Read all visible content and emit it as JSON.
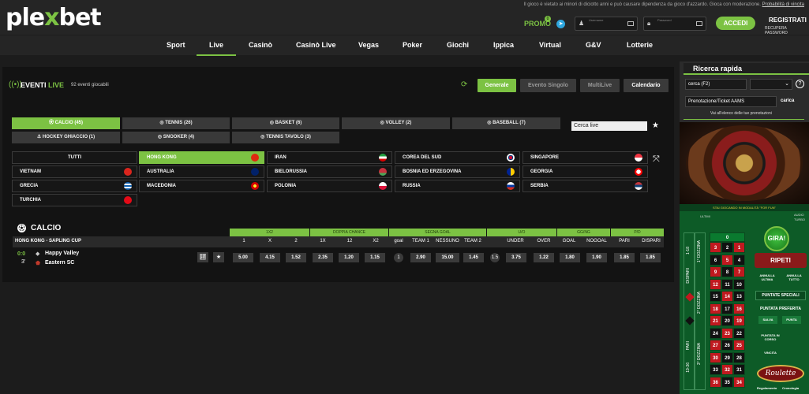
{
  "header": {
    "logo": "plexbet",
    "notice": "Il gioco è vietato ai minori di diciotto anni e può causare dipendenza da gioco d'azzardo. Gioca con moderazione.",
    "notice_link": "Probabilità di vincita",
    "promo": "PROMO",
    "promo_badge": "0",
    "username_label": "Username",
    "password_label": "Password",
    "login_button": "ACCEDI",
    "register": "REGISTRATI",
    "recover": "RECUPERA PASSWORD"
  },
  "nav": [
    "Sport",
    "Live",
    "Casinò",
    "Casinò Live",
    "Vegas",
    "Poker",
    "Giochi",
    "Ippica",
    "Virtual",
    "G&V",
    "Lotterie"
  ],
  "events": {
    "title_a": "EVENTI",
    "title_b": "LIVE",
    "count": "92 eventi giocabili",
    "tabs": [
      "Generale",
      "Evento Singolo",
      "MultiLive",
      "Calendario"
    ],
    "sports": [
      "CALCIO (45)",
      "TENNIS (26)",
      "BASKET (6)",
      "VOLLEY (2)",
      "BASEBALL (7)",
      "HOCKEY GHIACCIO (1)",
      "SNOOKER (4)",
      "TENNIS TAVOLO (3)"
    ],
    "search_placeholder": "Cerca live",
    "countries": [
      "TUTTI",
      "HONG KONG",
      "IRAN",
      "COREA DEL SUD",
      "SINGAPORE",
      "VIETNAM",
      "AUSTRALIA",
      "BIELORUSSIA",
      "BOSNIA ED ERZEGOVINA",
      "GEORGIA",
      "GRECIA",
      "MACEDONIA",
      "POLONIA",
      "RUSSIA",
      "SERBIA",
      "TURCHIA"
    ]
  },
  "market": {
    "section": "CALCIO",
    "groups": [
      "1X2",
      "DOPPIA CHANCE",
      "SEGNA GOAL",
      "U/O",
      "GG/NG",
      "P/D"
    ],
    "league": "HONG KONG - SAPLING CUP",
    "cols": [
      "1",
      "X",
      "2",
      "1X",
      "12",
      "X2",
      "goal",
      "TEAM 1",
      "NESSUNO",
      "TEAM 2",
      "UNDER",
      "OVER",
      "GOAL",
      "NOGOAL",
      "PARI",
      "DISPARI"
    ],
    "match": {
      "score": "0:0",
      "minute": "3'",
      "team1": "Happy Valley",
      "team2": "Eastern SC",
      "odds": [
        "5.00",
        "4.15",
        "1.52",
        "2.35",
        "1.20",
        "1.15",
        "2.90",
        "15.00",
        "1.45",
        "3.75",
        "1.22",
        "1.80",
        "1.90",
        "1.85",
        "1.85"
      ],
      "goal_line": "1",
      "uo_line": "1.5"
    }
  },
  "sidebar": {
    "title": "Ricerca rapida",
    "search": "cerca (F2)",
    "ticket": "Prenotazione/Ticket AAMS",
    "ticket_btn": "carica",
    "link": "Vai all'elenco delle tue prenotazioni"
  },
  "roulette": {
    "fun": "STAI GIOCANDO IN MODALITÀ \"FOR FUN\"",
    "ultimi": "ULTIMI",
    "audio": "AUDIO",
    "turbo": "TURBO",
    "gira": "GIRA!",
    "ripeti": "RIPETI",
    "annulla_ultima": "ANNULLA ULTIMA",
    "annulla_tutto": "ANNULLA TUTTO",
    "puntate_speciali": "PUNTATE SPECIALI",
    "puntata_preferita": "PUNTATA PREFERITA",
    "salva": "SALVA",
    "punta": "PUNTA",
    "puntata_in_corso": "PUNTATA IN CORSO",
    "vincita": "VINCITA",
    "logo": "Roulette",
    "regolamento": "Regolamento",
    "cronologia": "Cronologia",
    "side_labels": [
      "1-18",
      "DISPARI",
      "1° DOZZINA",
      "2° DOZZINA",
      "3° DOZZINA",
      "PARI",
      "19-36"
    ],
    "numbers": [
      [
        "0"
      ],
      [
        "3",
        "2",
        "1"
      ],
      [
        "6",
        "5",
        "4"
      ],
      [
        "9",
        "8",
        "7"
      ],
      [
        "12",
        "11",
        "10"
      ],
      [
        "15",
        "14",
        "13"
      ],
      [
        "18",
        "17",
        "16"
      ],
      [
        "21",
        "20",
        "19"
      ],
      [
        "24",
        "23",
        "22"
      ],
      [
        "27",
        "26",
        "25"
      ],
      [
        "30",
        "29",
        "28"
      ],
      [
        "33",
        "32",
        "31"
      ],
      [
        "36",
        "35",
        "34"
      ]
    ]
  }
}
